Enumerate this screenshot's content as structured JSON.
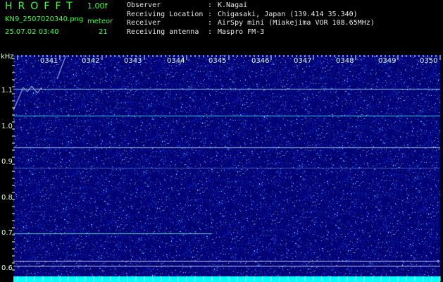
{
  "header": {
    "app_title": "HROFFT",
    "version": "1.00f",
    "filename": "KN9_2507020340.png",
    "datetime": "25.07.02 03:40",
    "meteor_label": "meteor",
    "meteor_count": "21"
  },
  "metadata": [
    {
      "key": "Observer",
      "value": "K.Nagai"
    },
    {
      "key": "Receiving Location",
      "value": "Chigasaki, Japan (139.414 35.340)"
    },
    {
      "key": "Receiver",
      "value": "AirSpy mini (Miakejima VOR 108.65MHz)"
    },
    {
      "key": "Receiving antenna",
      "value": "Maspro FM-3"
    }
  ],
  "axis": {
    "unit": "kHz",
    "y_ticks": [
      "1.1",
      "1.0",
      "0.9",
      "0.8",
      "0.7",
      "0.6"
    ],
    "x_ticks": [
      "0341",
      "0342",
      "0343",
      "0344",
      "0345",
      "0346",
      "0347",
      "0348",
      "0349",
      "0350"
    ]
  },
  "colors": {
    "background": "#000000",
    "header_text": "#40ff40",
    "spectrogram_base": "#00006e",
    "signal_cyan": "#00ffff"
  }
}
